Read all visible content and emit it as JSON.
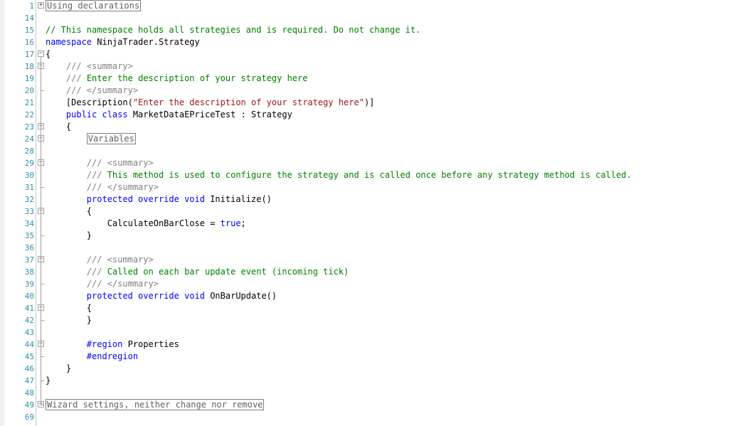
{
  "editor": {
    "lines": [
      {
        "num": "1",
        "fold": "+",
        "segments": [
          {
            "text": "Using declarations",
            "cls": "collapsed"
          }
        ]
      },
      {
        "num": "14",
        "fold": "",
        "segments": []
      },
      {
        "num": "15",
        "fold": "",
        "segments": [
          {
            "text": "// This namespace holds all strategies and is required. Do not change it.",
            "cls": "cm"
          }
        ]
      },
      {
        "num": "16",
        "fold": "",
        "segments": [
          {
            "text": "namespace",
            "cls": "kw"
          },
          {
            "text": " NinjaTrader.Strategy",
            "cls": ""
          }
        ]
      },
      {
        "num": "17",
        "fold": "-",
        "segments": [
          {
            "text": "{",
            "cls": ""
          }
        ]
      },
      {
        "num": "18",
        "fold": "-",
        "segments": [
          {
            "text": "    ",
            "cls": ""
          },
          {
            "text": "/// <summary>",
            "cls": "doc"
          }
        ]
      },
      {
        "num": "19",
        "fold": "",
        "segments": [
          {
            "text": "    ",
            "cls": ""
          },
          {
            "text": "///",
            "cls": "doc"
          },
          {
            "text": " Enter the description of your strategy here",
            "cls": "cm"
          }
        ]
      },
      {
        "num": "20",
        "fold": "",
        "segments": [
          {
            "text": "    ",
            "cls": ""
          },
          {
            "text": "/// </summary>",
            "cls": "doc"
          }
        ]
      },
      {
        "num": "21",
        "fold": "",
        "segments": [
          {
            "text": "    [Description(",
            "cls": ""
          },
          {
            "text": "\"Enter the description of your strategy here\"",
            "cls": "str"
          },
          {
            "text": ")]",
            "cls": ""
          }
        ]
      },
      {
        "num": "22",
        "fold": "",
        "segments": [
          {
            "text": "    ",
            "cls": ""
          },
          {
            "text": "public class",
            "cls": "kw"
          },
          {
            "text": " MarketDataEPriceTest : Strategy",
            "cls": ""
          }
        ]
      },
      {
        "num": "23",
        "fold": "-",
        "segments": [
          {
            "text": "    {",
            "cls": ""
          }
        ]
      },
      {
        "num": "24",
        "fold": "+",
        "segments": [
          {
            "text": "        ",
            "cls": ""
          },
          {
            "text": "Variables",
            "cls": "collapsed"
          }
        ]
      },
      {
        "num": "28",
        "fold": "",
        "segments": []
      },
      {
        "num": "29",
        "fold": "-",
        "segments": [
          {
            "text": "        ",
            "cls": ""
          },
          {
            "text": "/// <summary>",
            "cls": "doc"
          }
        ]
      },
      {
        "num": "30",
        "fold": "",
        "segments": [
          {
            "text": "        ",
            "cls": ""
          },
          {
            "text": "///",
            "cls": "doc"
          },
          {
            "text": " This method is used to configure the strategy and is called once before any strategy method is called.",
            "cls": "cm"
          }
        ]
      },
      {
        "num": "31",
        "fold": "",
        "segments": [
          {
            "text": "        ",
            "cls": ""
          },
          {
            "text": "/// </summary>",
            "cls": "doc"
          }
        ]
      },
      {
        "num": "32",
        "fold": "",
        "segments": [
          {
            "text": "        ",
            "cls": ""
          },
          {
            "text": "protected override void",
            "cls": "kw"
          },
          {
            "text": " Initialize()",
            "cls": ""
          }
        ]
      },
      {
        "num": "33",
        "fold": "-",
        "segments": [
          {
            "text": "        {",
            "cls": ""
          }
        ]
      },
      {
        "num": "34",
        "fold": "",
        "segments": [
          {
            "text": "            CalculateOnBarClose = ",
            "cls": ""
          },
          {
            "text": "true",
            "cls": "kw"
          },
          {
            "text": ";",
            "cls": ""
          }
        ]
      },
      {
        "num": "35",
        "fold": "",
        "segments": [
          {
            "text": "        }",
            "cls": ""
          }
        ]
      },
      {
        "num": "36",
        "fold": "",
        "segments": []
      },
      {
        "num": "37",
        "fold": "-",
        "segments": [
          {
            "text": "        ",
            "cls": ""
          },
          {
            "text": "/// <summary>",
            "cls": "doc"
          }
        ]
      },
      {
        "num": "38",
        "fold": "",
        "segments": [
          {
            "text": "        ",
            "cls": ""
          },
          {
            "text": "///",
            "cls": "doc"
          },
          {
            "text": " Called on each bar update event (incoming tick)",
            "cls": "cm"
          }
        ]
      },
      {
        "num": "39",
        "fold": "",
        "segments": [
          {
            "text": "        ",
            "cls": ""
          },
          {
            "text": "/// </summary>",
            "cls": "doc"
          }
        ]
      },
      {
        "num": "40",
        "fold": "",
        "segments": [
          {
            "text": "        ",
            "cls": ""
          },
          {
            "text": "protected override void",
            "cls": "kw"
          },
          {
            "text": " OnBarUpdate()",
            "cls": ""
          }
        ]
      },
      {
        "num": "41",
        "fold": "-",
        "segments": [
          {
            "text": "        {",
            "cls": ""
          }
        ]
      },
      {
        "num": "42",
        "fold": "",
        "segments": [
          {
            "text": "        }",
            "cls": ""
          }
        ]
      },
      {
        "num": "43",
        "fold": "",
        "segments": []
      },
      {
        "num": "44",
        "fold": "-",
        "segments": [
          {
            "text": "        ",
            "cls": ""
          },
          {
            "text": "#region",
            "cls": "kw"
          },
          {
            "text": " Properties",
            "cls": ""
          }
        ]
      },
      {
        "num": "45",
        "fold": "",
        "segments": [
          {
            "text": "        ",
            "cls": ""
          },
          {
            "text": "#endregion",
            "cls": "kw"
          }
        ]
      },
      {
        "num": "46",
        "fold": "",
        "segments": [
          {
            "text": "    }",
            "cls": ""
          }
        ]
      },
      {
        "num": "47",
        "fold": "",
        "segments": [
          {
            "text": "}",
            "cls": ""
          }
        ]
      },
      {
        "num": "48",
        "fold": "",
        "segments": []
      },
      {
        "num": "49",
        "fold": "+",
        "segments": [
          {
            "text": "Wizard settings, neither change nor remove",
            "cls": "collapsed"
          }
        ]
      },
      {
        "num": "69",
        "fold": "",
        "segments": []
      }
    ]
  }
}
